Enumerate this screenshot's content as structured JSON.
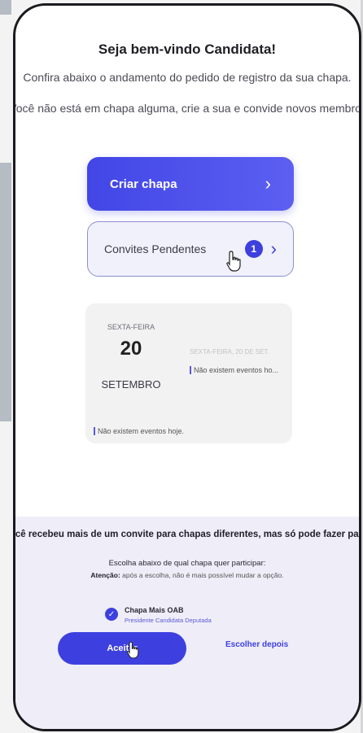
{
  "header": {
    "title": "Seja bem-vindo Candidata!",
    "subtitle": "Confira abaixo o andamento do pedido de registro da sua chapa.",
    "info": "Você não está em chapa alguma, crie a sua e convide novos membros!"
  },
  "actions": {
    "create_label": "Criar chapa",
    "pending_label": "Convites Pendentes",
    "pending_count": "1",
    "chevron": "›"
  },
  "calendar": {
    "weekday": "SEXTA-FEIRA",
    "day": "20",
    "month": "SETEMBRO",
    "full_date": "SEXTA-FEIRA, 20 DE SET.",
    "event_truncated": "Não existem eventos ho...",
    "event_today": "Não existem eventos hoje."
  },
  "invite_panel": {
    "message": "Você recebeu mais de um convite para chapas diferentes, mas só pode fazer parte de uma.",
    "question": "Escolha abaixo de qual chapa quer participar:",
    "warning_label": "Atenção:",
    "warning_text": " após a escolha, não é mais possível mudar a opção.",
    "option_name": "Chapa Mais OAB",
    "option_role": "Presidente Candidata Deputada",
    "check_icon": "✓",
    "accept_label": "Aceitar",
    "later_label": "Escolher depois"
  },
  "colors": {
    "accent": "#3d40df",
    "panel_bg": "#efedf8"
  }
}
